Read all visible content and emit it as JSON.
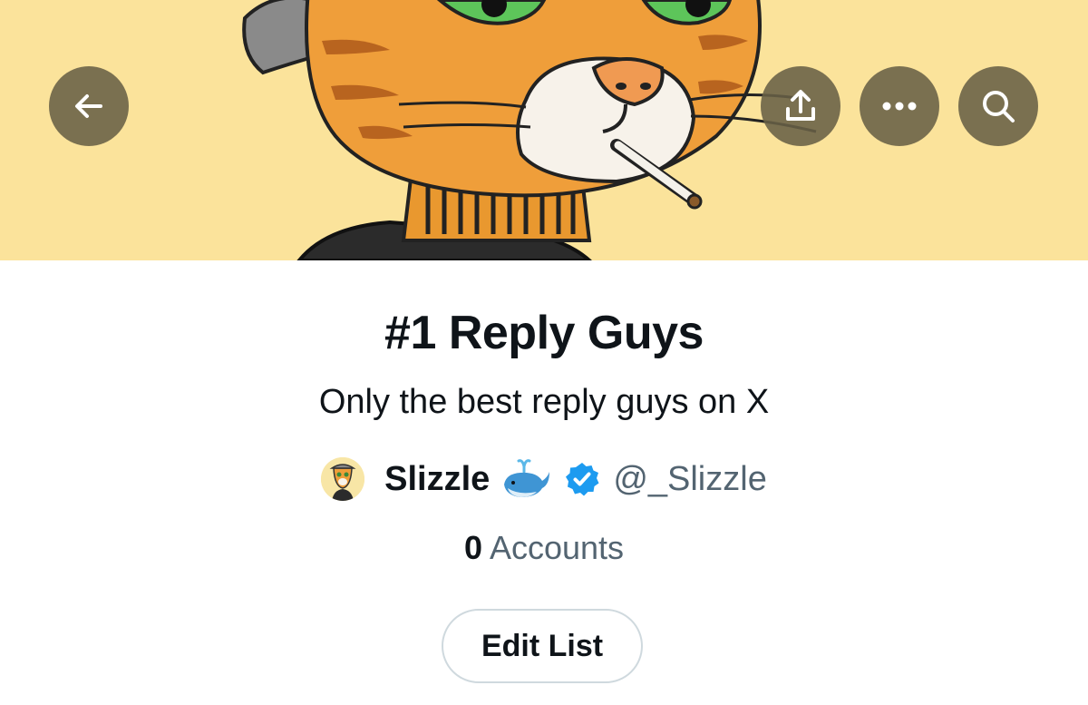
{
  "list": {
    "title": "#1 Reply Guys",
    "description": "Only the best reply guys on X"
  },
  "owner": {
    "name": "Slizzle",
    "handle": "@_Slizzle",
    "avatar_icon": "cat-avatar-icon",
    "emoji_icon": "whale-icon",
    "verified_icon": "verified-badge-icon"
  },
  "stats": {
    "accounts_count": "0",
    "accounts_label": "Accounts"
  },
  "actions": {
    "edit_label": "Edit List"
  },
  "header_buttons": {
    "back_icon": "back-arrow-icon",
    "share_icon": "share-icon",
    "more_icon": "more-icon",
    "search_icon": "search-icon"
  },
  "colors": {
    "banner_background": "#fbe39b",
    "header_button_background": "#686046",
    "text_primary": "#0f1419",
    "text_secondary": "#536471",
    "verified_blue": "#1d9bf0",
    "button_border": "#cfd9de"
  }
}
